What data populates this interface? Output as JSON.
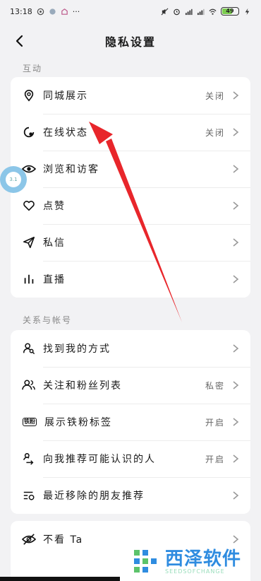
{
  "status_bar": {
    "time": "13:18",
    "dots": "···",
    "battery": "49"
  },
  "header": {
    "title": "隐私设置"
  },
  "sections": [
    {
      "label": "互动",
      "items": [
        {
          "icon": "location-pin-icon",
          "label": "同城展示",
          "value": "关闭"
        },
        {
          "icon": "online-status-icon",
          "label": "在线状态",
          "value": "关闭"
        },
        {
          "icon": "eye-icon",
          "label": "浏览和访客",
          "value": ""
        },
        {
          "icon": "heart-icon",
          "label": "点赞",
          "value": ""
        },
        {
          "icon": "send-icon",
          "label": "私信",
          "value": ""
        },
        {
          "icon": "bar-chart-icon",
          "label": "直播",
          "value": ""
        }
      ]
    },
    {
      "label": "关系与帐号",
      "items": [
        {
          "icon": "find-person-icon",
          "label": "找到我的方式",
          "value": ""
        },
        {
          "icon": "users-icon",
          "label": "关注和粉丝列表",
          "value": "私密"
        },
        {
          "icon": "fan-badge-icon",
          "badge_text": "铁粉",
          "label": "展示铁粉标签",
          "value": "开启"
        },
        {
          "icon": "recommend-people-icon",
          "label": "向我推荐可能认识的人",
          "value": "开启"
        },
        {
          "icon": "removed-list-icon",
          "label": "最近移除的朋友推荐",
          "value": ""
        }
      ]
    },
    {
      "label": "",
      "items": [
        {
          "icon": "eye-off-icon",
          "label": "不看 Ta",
          "value": ""
        }
      ]
    }
  ],
  "floating_bubble": {
    "text": "3.1"
  },
  "watermark": {
    "text": "西泽软件",
    "sub": "SEEDSOFCHANGE"
  },
  "colors": {
    "background": "#f2f2f4",
    "card": "#ffffff",
    "arrow": "#e8262b",
    "watermark": "#2f8ce0"
  }
}
